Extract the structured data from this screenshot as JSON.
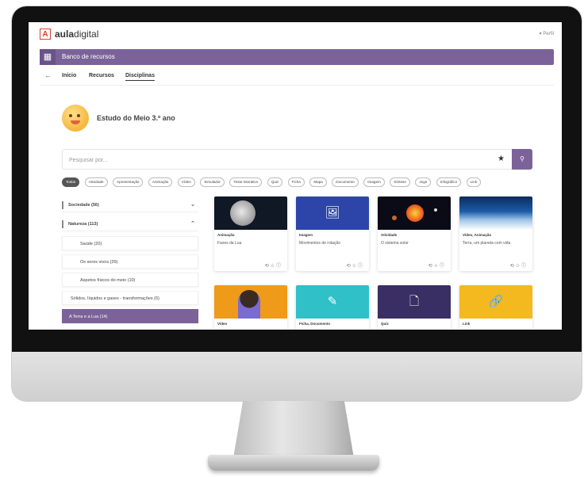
{
  "app": {
    "logo_letter": "A",
    "logo_text_bold": "aula",
    "logo_text_rest": "digital",
    "user_label": "▾ Perfil"
  },
  "header": {
    "menu_icon": "grid-icon",
    "title": "Banco de recursos"
  },
  "nav": {
    "back_icon": "arrow-left-icon",
    "items": [
      "Início",
      "Recursos",
      "Disciplinas"
    ]
  },
  "page": {
    "title": "Estudo do Meio 3.º ano"
  },
  "search": {
    "placeholder": "Pesquisar por..."
  },
  "filters": [
    "Todos",
    "Atividade",
    "Apresentação",
    "Animação",
    "Vídeo",
    "Simulador",
    "Teste interativo",
    "Quiz",
    "Ficha",
    "Mapa",
    "Documento",
    "Imagem",
    "Síntese",
    "Jogo",
    "Infográfico",
    "Link"
  ],
  "sidebar": {
    "categories": [
      {
        "label": "Sociedade (56)",
        "expanded": false
      },
      {
        "label": "Natureza (113)",
        "expanded": true
      }
    ],
    "subitems": [
      {
        "label": "Saúde (20)",
        "active": false
      },
      {
        "label": "Os seres vivos (39)",
        "active": false
      },
      {
        "label": "Aspetos físicos do meio (10)",
        "active": false
      },
      {
        "label": "Sólidos, líquidos e gases - transformações (6)",
        "active": false
      },
      {
        "label": "A Terra e a Lua (14)",
        "active": true
      }
    ]
  },
  "cards": [
    {
      "type": "Animação",
      "title": "Fases da Lua",
      "thumb": "moon"
    },
    {
      "type": "Imagem",
      "title": "Movimentos de rotação",
      "thumb": "image-icon"
    },
    {
      "type": "Atividade",
      "title": "O sistema solar",
      "thumb": "solar"
    },
    {
      "type": "Vídeo, Animação",
      "title": "Terra, um planeta com vida",
      "thumb": "earth"
    },
    {
      "type": "Vídeo",
      "title": "",
      "thumb": "person"
    },
    {
      "type": "Ficha, Documento",
      "title": "",
      "thumb": "pencil-icon"
    },
    {
      "type": "Quiz",
      "title": "",
      "thumb": "quiz-doc-icon"
    },
    {
      "type": "Link",
      "title": "",
      "thumb": "link-icon"
    }
  ],
  "colors": {
    "primary": "#7b6399",
    "logo_red": "#d8412f",
    "image_blue": "#2d45a8",
    "teal": "#2fc0c8",
    "dark_purple": "#3a2f65",
    "yellow": "#f3b91f",
    "orange": "#f09a1a"
  }
}
